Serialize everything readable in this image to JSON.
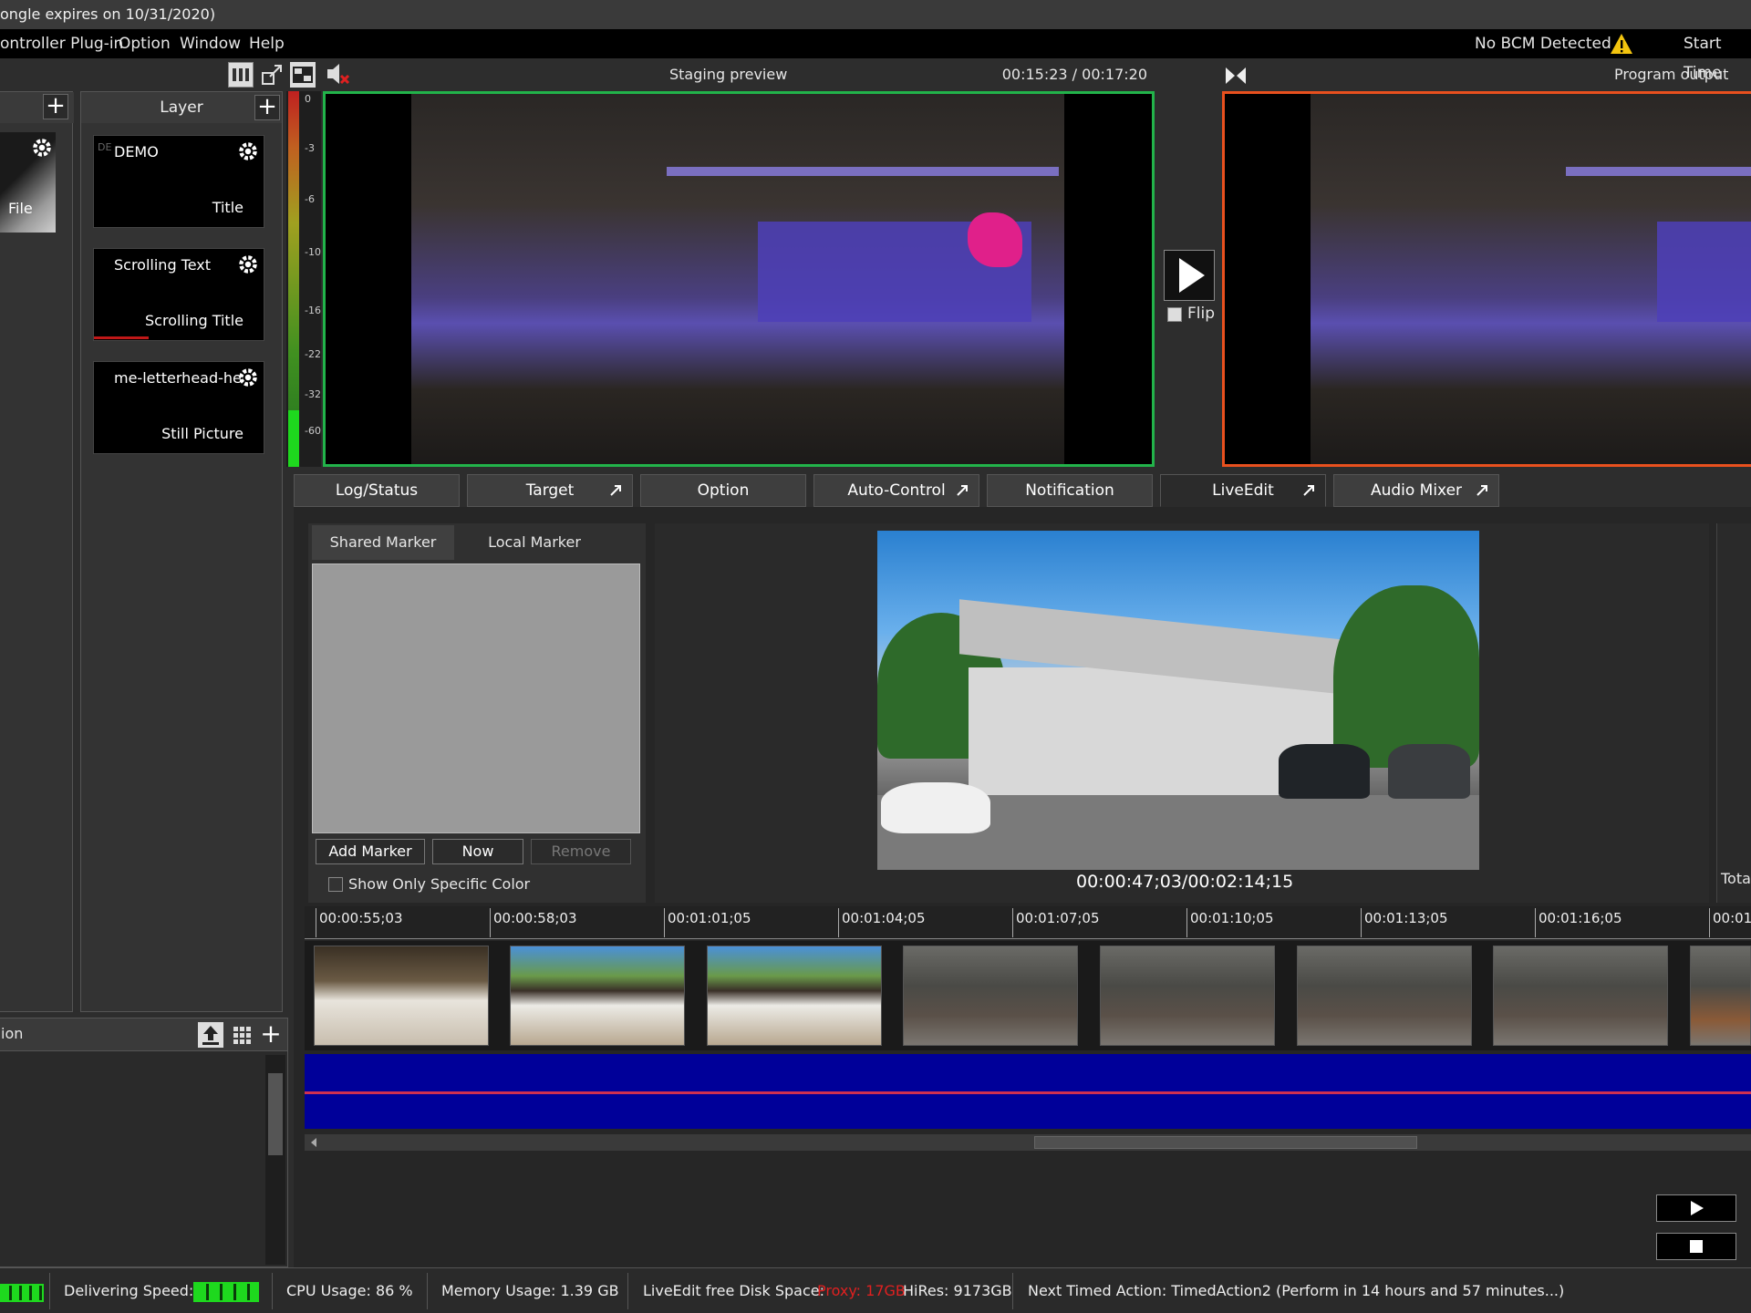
{
  "title_bar": {
    "text": "ongle expires on 10/31/2020)"
  },
  "menu": {
    "items": [
      "ontroller Plug-in",
      "Option",
      "Window",
      "Help"
    ],
    "bcm_status": "No BCM Detected",
    "start_time": "Start Time"
  },
  "left_panel": {
    "items": [
      {
        "type": "File"
      }
    ]
  },
  "layer_panel": {
    "header": "Layer",
    "items": [
      {
        "name": "DEMO",
        "badge": "DE",
        "type": "Title"
      },
      {
        "name": "Scrolling Text",
        "type": "Scrolling Title"
      },
      {
        "name": "me-letterhead-hea",
        "type": "Still Picture"
      }
    ]
  },
  "bottom_left": {
    "label": "ion"
  },
  "staging": {
    "title": "Staging preview",
    "timecode": "00:15:23 / 00:17:20"
  },
  "audio_meter": {
    "scale": [
      "0",
      "-3",
      "-6",
      "-10",
      "-16",
      "-22",
      "-32",
      "-60"
    ],
    "level": 0.15
  },
  "transport": {
    "flip_label": "Flip"
  },
  "program": {
    "title": "Program output"
  },
  "tabs": [
    {
      "label": "Log/Status",
      "popout": false
    },
    {
      "label": "Target",
      "popout": true
    },
    {
      "label": "Option",
      "popout": false
    },
    {
      "label": "Auto-Control",
      "popout": true
    },
    {
      "label": "Notification",
      "popout": false
    },
    {
      "label": "LiveEdit",
      "popout": true,
      "active": true
    },
    {
      "label": "Audio Mixer",
      "popout": true
    }
  ],
  "liveedit": {
    "marker_tabs": [
      "Shared Marker",
      "Local Marker"
    ],
    "buttons": {
      "add": "Add Marker",
      "now": "Now",
      "remove": "Remove"
    },
    "show_color_label": "Show Only Specific Color",
    "clip_timecode": "00:00:47;03/00:02:14;15",
    "total_label": "Total",
    "timeline_ticks": [
      "00:00:55;03",
      "00:00:58;03",
      "00:01:01;05",
      "00:01:04;05",
      "00:01:07;05",
      "00:01:10;05",
      "00:01:13;05",
      "00:01:16;05",
      "00:01:"
    ]
  },
  "statusbar": {
    "delivering_label": "Delivering Speed:",
    "cpu": "CPU Usage:  86 %",
    "memory": "Memory Usage: 1.39 GB",
    "disk_label": "LiveEdit free Disk Space:",
    "proxy": "Proxy: 17GB",
    "hires": "HiRes: 9173GB",
    "next_action": "Next Timed Action:  TimedAction2 (Perform in 14 hours and 57 minutes...)"
  },
  "colors": {
    "staging_border": "#22b34a",
    "program_border": "#e8501e",
    "audio_wave": "#000099",
    "meter_green": "#1ed81e"
  }
}
